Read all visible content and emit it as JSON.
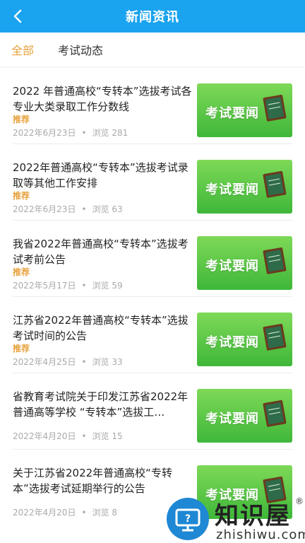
{
  "header": {
    "title": "新闻资讯"
  },
  "tabs": [
    {
      "label": "全部",
      "active": true
    },
    {
      "label": "考试动态",
      "active": false
    }
  ],
  "news": [
    {
      "title": "2022 年普通高校“专转本”选拔考试各专业大类录取工作分数线",
      "tag": "推荐",
      "date": "2022年6月23日",
      "views": "浏览 281",
      "thumb_text": "考试要闻"
    },
    {
      "title": "2022年普通高校“专转本”选拔考试录取等其他工作安排",
      "tag": "推荐",
      "date": "2022年6月23日",
      "views": "浏览 63",
      "thumb_text": "考试要闻"
    },
    {
      "title": "我省2022年普通高校“专转本”选拔考试考前公告",
      "tag": "推荐",
      "date": "2022年5月17日",
      "views": "浏览 59",
      "thumb_text": "考试要闻"
    },
    {
      "title": "江苏省2022年普通高校“专转本”选拔考试时间的公告",
      "tag": "推荐",
      "date": "2022年4月25日",
      "views": "浏览 33",
      "thumb_text": "考试要闻"
    },
    {
      "title": "省教育考试院关于印发江苏省2022年普通高等学校 “专转本”选拔工…",
      "tag": "",
      "date": "2022年4月20日",
      "views": "浏览 15",
      "thumb_text": "考试要闻"
    },
    {
      "title": "关于江苏省2022年普通高校“专转本”选拔考试延期举行的公告",
      "tag": "",
      "date": "2022年4月20日",
      "views": "浏览 8",
      "thumb_text": "考试要闻"
    }
  ],
  "meta_separator": "•",
  "watermark": {
    "brand": "知识屋",
    "domain": "zhishiwu.com",
    "mark": "®"
  },
  "colors": {
    "header": "#1aa3ee",
    "accent": "#e6a23c",
    "thumb": "#4cbd3f"
  }
}
